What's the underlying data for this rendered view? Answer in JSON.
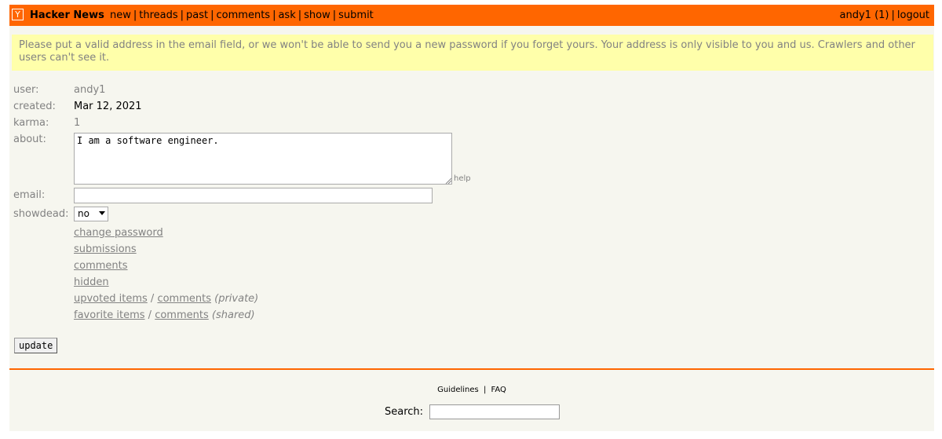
{
  "header": {
    "logo": "Y",
    "brand": "Hacker News",
    "nav": [
      "new",
      "threads",
      "past",
      "comments",
      "ask",
      "show",
      "submit"
    ],
    "separator": "|",
    "user_link": "andy1 (1)",
    "logout": "logout"
  },
  "notice": "Please put a valid address in the email field, or we won't be able to send you a new password if you forget yours. Your address is only visible to you and us. Crawlers and other users can't see it.",
  "profile": {
    "user_label": "user:",
    "user_value": "andy1",
    "created_label": "created:",
    "created_value": "Mar 12, 2021",
    "karma_label": "karma:",
    "karma_value": "1",
    "about_label": "about:",
    "about_value": "I am a software engineer.",
    "help": "help",
    "email_label": "email:",
    "email_value": "",
    "showdead_label": "showdead:",
    "showdead_value": "no"
  },
  "links": {
    "change_password": "change password",
    "submissions": "submissions",
    "comments": "comments",
    "hidden": "hidden",
    "upvoted_items": "upvoted items",
    "upvoted_comments": "comments",
    "private_note": "(private)",
    "favorite_items": "favorite items",
    "favorite_comments": "comments",
    "shared_note": "(shared)",
    "slash": "/"
  },
  "update_button": "update",
  "footer": {
    "guidelines": "Guidelines",
    "faq": "FAQ",
    "separator": "|",
    "search_label": "Search:",
    "search_value": ""
  },
  "colors": {
    "header": "#ff6600",
    "background": "#f6f6ef",
    "notice_bg": "#ffffaa",
    "muted_text": "#828282"
  }
}
